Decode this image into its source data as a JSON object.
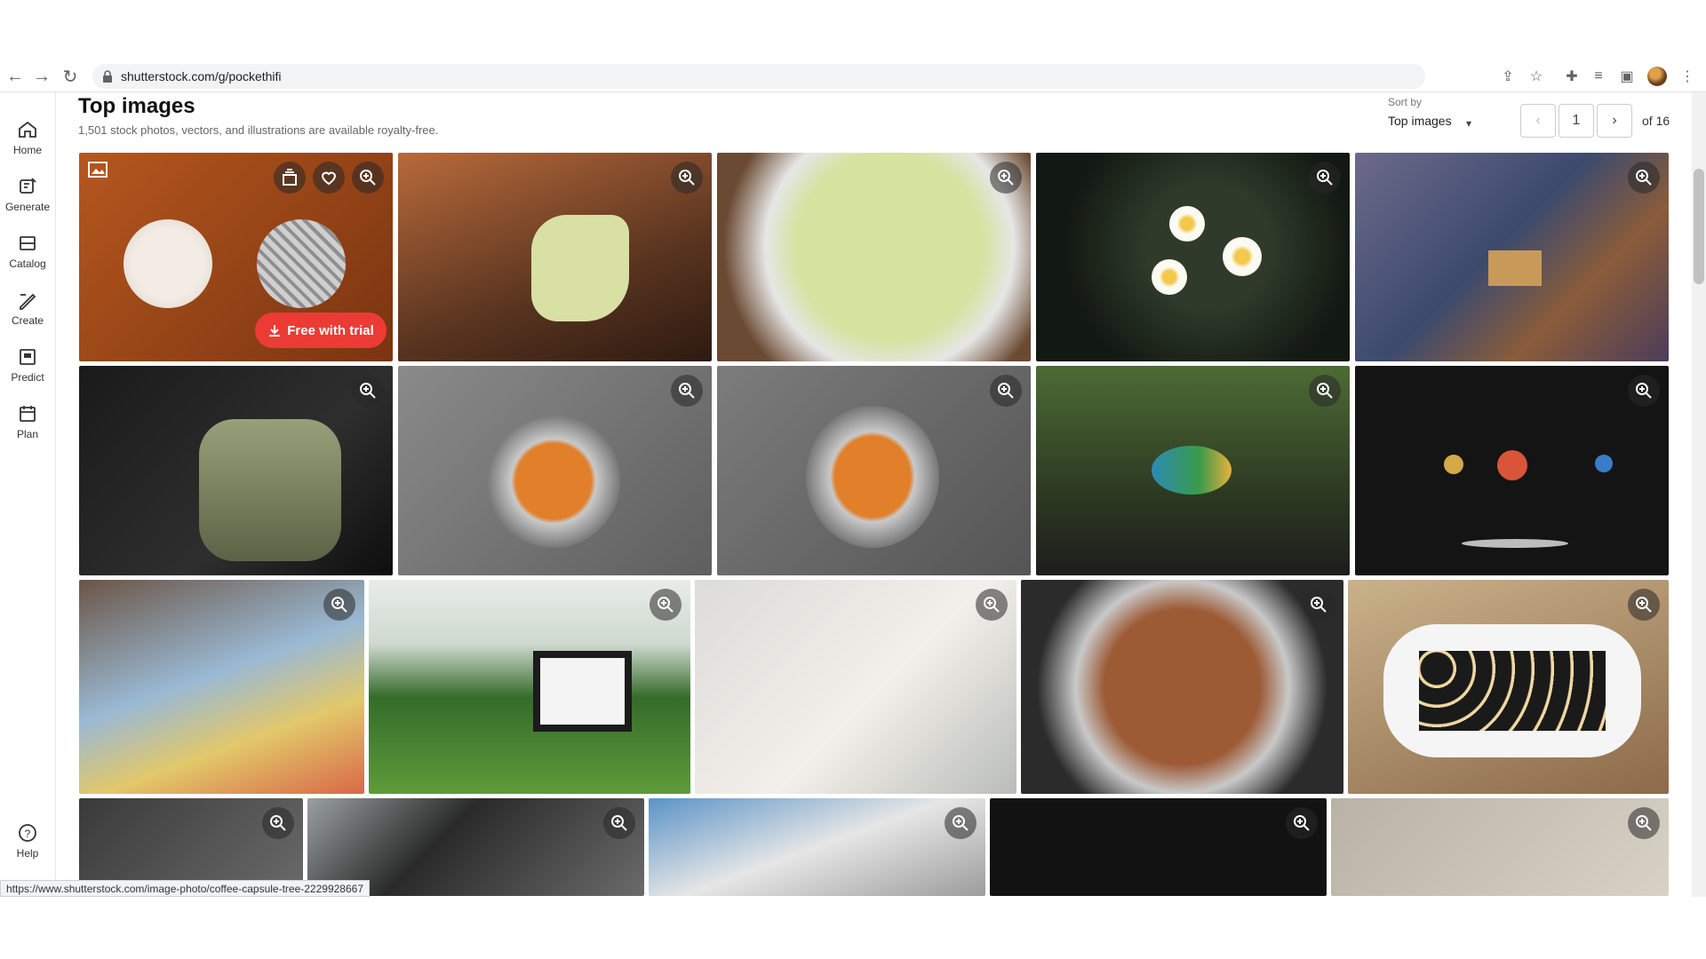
{
  "browser": {
    "url": "shutterstock.com/g/pockethifi",
    "status_url": "https://www.shutterstock.com/image-photo/coffee-capsule-tree-2229928667"
  },
  "sidebar": {
    "items": [
      {
        "label": "Home",
        "icon": "home-icon"
      },
      {
        "label": "Generate",
        "icon": "generate-icon"
      },
      {
        "label": "Catalog",
        "icon": "catalog-icon"
      },
      {
        "label": "Create",
        "icon": "create-icon"
      },
      {
        "label": "Predict",
        "icon": "predict-icon"
      },
      {
        "label": "Plan",
        "icon": "plan-icon"
      }
    ],
    "help_label": "Help"
  },
  "header": {
    "title": "Top images",
    "subtitle": "1,501 stock photos, vectors, and illustrations are available royalty-free."
  },
  "sort": {
    "label": "Sort by",
    "value": "Top images"
  },
  "pagination": {
    "current": "1",
    "total_label": "of 16"
  },
  "first_tile": {
    "trial_label": "Free with trial"
  },
  "colors": {
    "trial_button": "#ec3b35",
    "zoom_overlay": "#282828"
  }
}
